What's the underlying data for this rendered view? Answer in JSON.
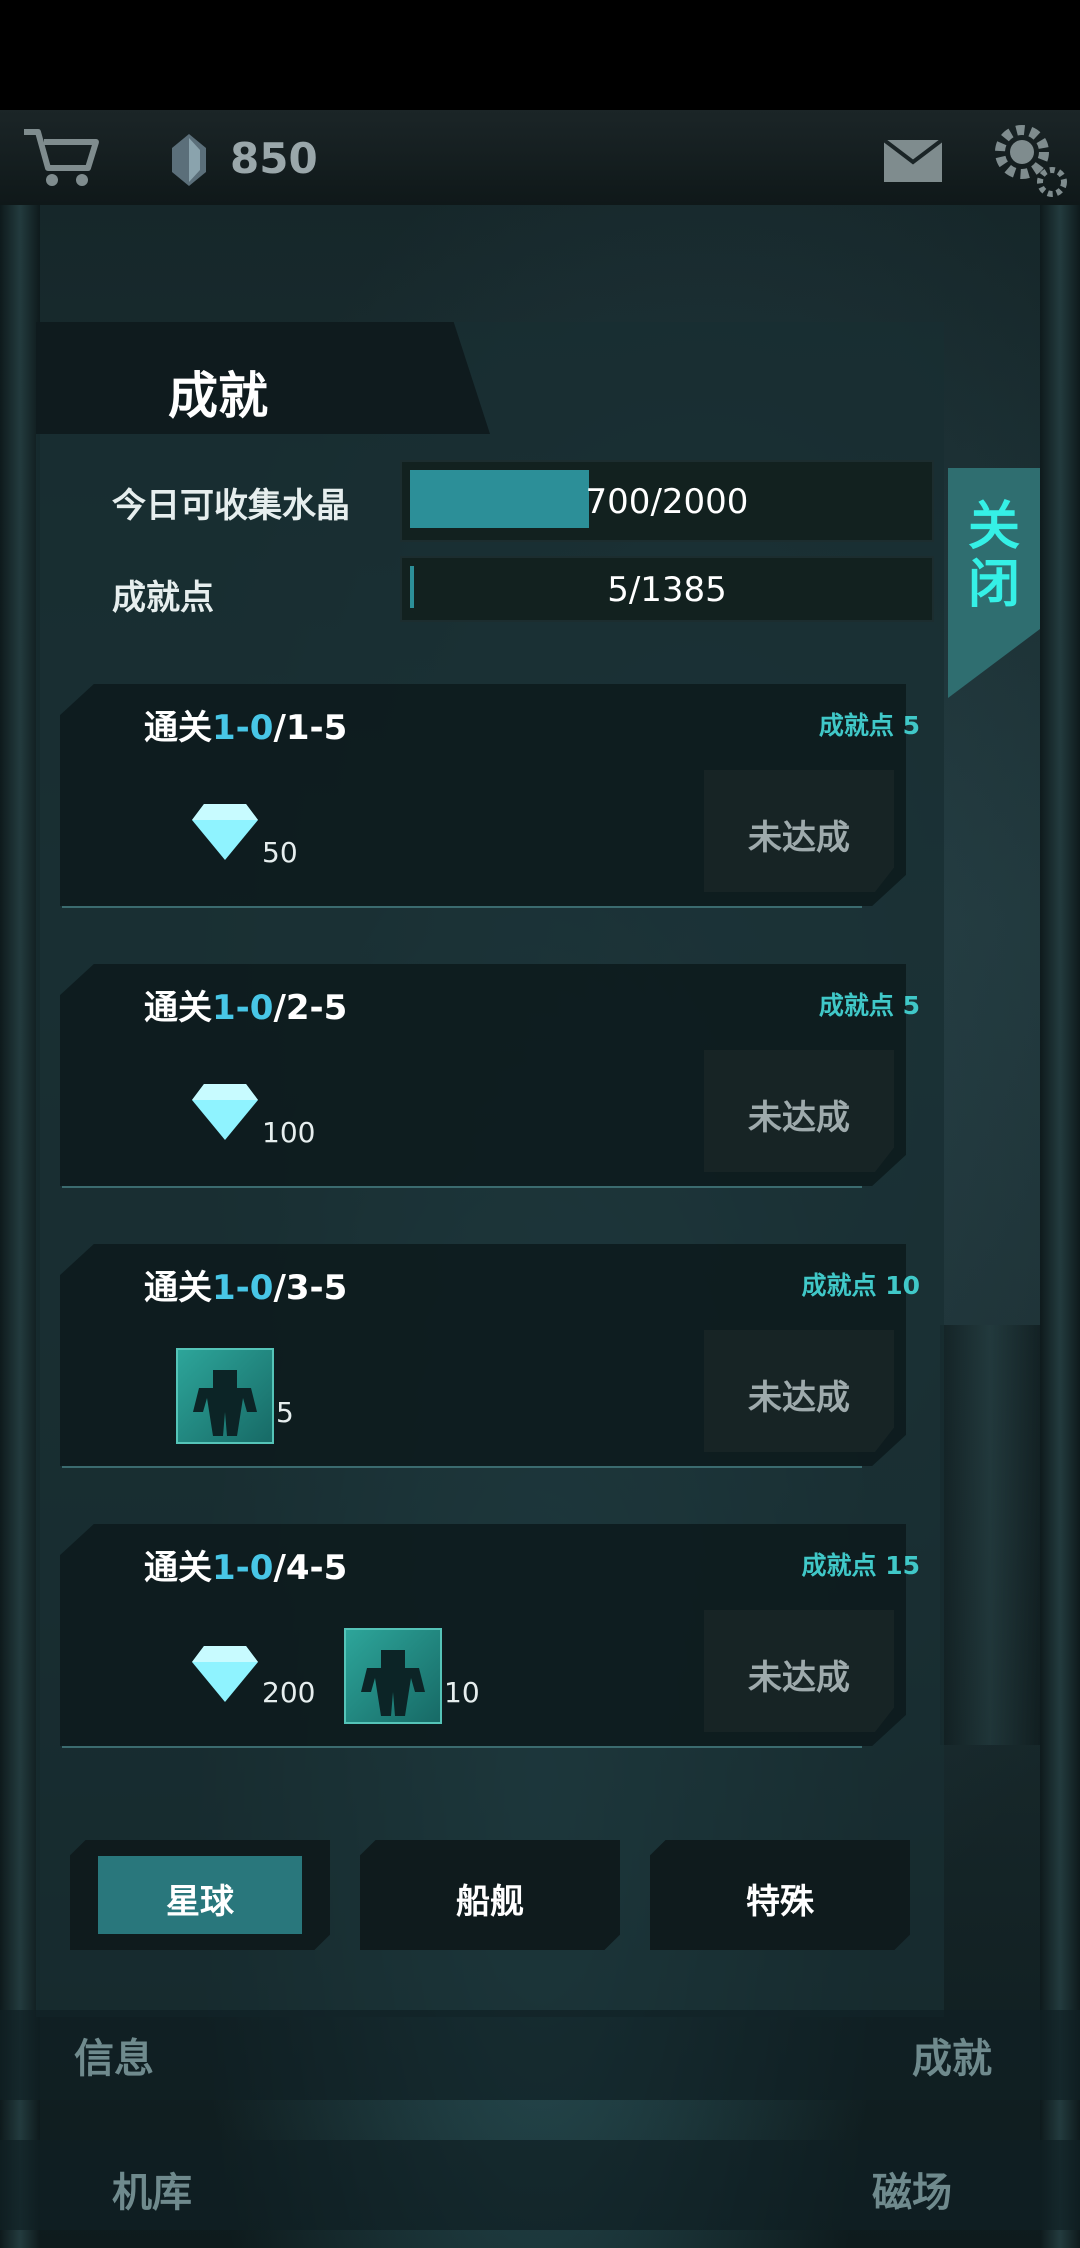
{
  "top_bar": {
    "crystal_count": "850"
  },
  "page": {
    "title": "成就",
    "close_label": "关闭"
  },
  "stats": {
    "daily_label": "今日可收集水晶",
    "daily_value": "700/2000",
    "daily_fraction": 0.35,
    "points_label": "成就点",
    "points_value": "5/1385",
    "points_fraction": 0.004
  },
  "achievements": [
    {
      "title_prefix": "通关",
      "title_highlight": "1-0",
      "title_suffix": "/1-5",
      "points": "成就点 5",
      "rewards": [
        {
          "type": "crystal",
          "amount": "50"
        }
      ],
      "status": "未达成"
    },
    {
      "title_prefix": "通关",
      "title_highlight": "1-0",
      "title_suffix": "/2-5",
      "points": "成就点 5",
      "rewards": [
        {
          "type": "crystal",
          "amount": "100"
        }
      ],
      "status": "未达成"
    },
    {
      "title_prefix": "通关",
      "title_highlight": "1-0",
      "title_suffix": "/3-5",
      "points": "成就点 10",
      "rewards": [
        {
          "type": "mech",
          "amount": "5"
        }
      ],
      "status": "未达成"
    },
    {
      "title_prefix": "通关",
      "title_highlight": "1-0",
      "title_suffix": "/4-5",
      "points": "成就点 15",
      "rewards": [
        {
          "type": "crystal",
          "amount": "200"
        },
        {
          "type": "mech",
          "amount": "10"
        }
      ],
      "status": "未达成"
    }
  ],
  "categories": [
    {
      "label": "星球",
      "active": true
    },
    {
      "label": "船舰",
      "active": false
    },
    {
      "label": "特殊",
      "active": false
    }
  ],
  "nav": {
    "info": "信息",
    "achievement": "成就",
    "hangar": "机库",
    "magnetic": "磁场"
  },
  "colors": {
    "accent": "#2c8f98",
    "highlight": "#48c6e6",
    "close_text": "#35f0e6"
  }
}
